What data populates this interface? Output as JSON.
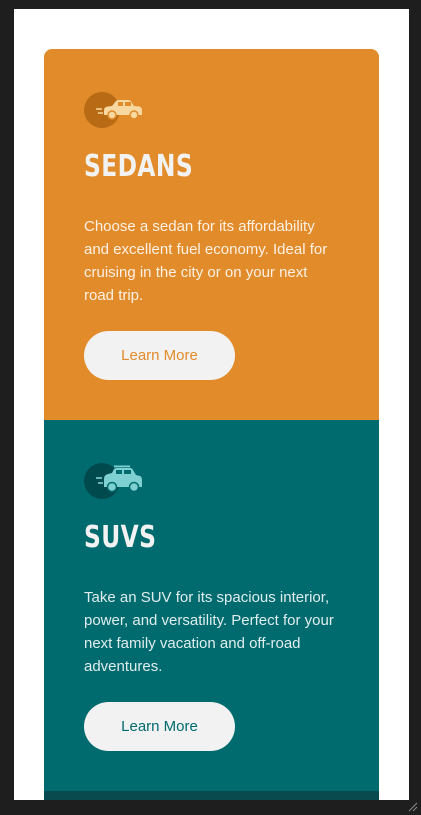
{
  "cards": [
    {
      "icon": "sedan-car-icon",
      "title": "Sedans",
      "text": "Choose a sedan for its affordability and excellent fuel economy. Ideal for cruising in the city or on your next road trip.",
      "button_label": "Learn More",
      "color": "#e28b2a"
    },
    {
      "icon": "suv-car-icon",
      "title": "SUVs",
      "text": "Take an SUV for its spacious interior, power, and versatility. Perfect for your next family vacation and off-road adventures.",
      "button_label": "Learn More",
      "color": "#006b6f"
    }
  ],
  "colors": {
    "sedans_bg": "#e28b2a",
    "suvs_bg": "#006b6f",
    "luxury_bg": "#084a4d",
    "button_bg": "#f2f2f2"
  }
}
